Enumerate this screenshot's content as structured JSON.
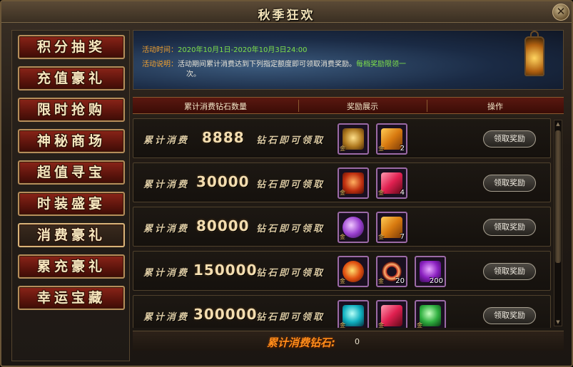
{
  "window": {
    "title": "秋季狂欢",
    "close_label": "✕"
  },
  "sidebar": {
    "items": [
      {
        "label": "积分抽奖",
        "active": false
      },
      {
        "label": "充值豪礼",
        "active": false
      },
      {
        "label": "限时抢购",
        "active": false
      },
      {
        "label": "神秘商场",
        "active": false
      },
      {
        "label": "超值寻宝",
        "active": false
      },
      {
        "label": "时装盛宴",
        "active": false
      },
      {
        "label": "消费豪礼",
        "active": true
      },
      {
        "label": "累充豪礼",
        "active": false
      },
      {
        "label": "幸运宝藏",
        "active": false
      }
    ]
  },
  "banner": {
    "time_label": "活动时间：",
    "time_value": "2020年10月1日-2020年10月3日24:00",
    "desc_label": "活动说明：",
    "desc_text": "活动期间累计消费达到下列指定额度即可领取消费奖励。",
    "desc_limit_line1": "每档奖励限领一",
    "desc_limit_line2": "次。"
  },
  "table": {
    "headers": [
      "累计消费钻石数量",
      "奖励展示",
      "操作"
    ]
  },
  "rows": [
    {
      "prefix": "累计消费",
      "amount": "8888",
      "suffix": "钻石即可领取",
      "button": "领取奖励",
      "items": [
        {
          "icon": "treasure-chest-icon",
          "bind": "金",
          "count": ""
        },
        {
          "icon": "scroll-icon",
          "bind": "金",
          "count": "2"
        }
      ]
    },
    {
      "prefix": "累计消费",
      "amount": "30000",
      "suffix": "钻石即可领取",
      "button": "领取奖励",
      "items": [
        {
          "icon": "red-chest-icon",
          "bind": "金",
          "count": ""
        },
        {
          "icon": "red-crystal-icon",
          "bind": "金",
          "count": "4"
        }
      ]
    },
    {
      "prefix": "累计消费",
      "amount": "80000",
      "suffix": "钻石即可领取",
      "button": "领取奖励",
      "items": [
        {
          "icon": "purple-orb-icon",
          "bind": "金",
          "count": ""
        },
        {
          "icon": "scroll-icon",
          "bind": "金",
          "count": "7"
        }
      ]
    },
    {
      "prefix": "累计消费",
      "amount": "150000",
      "suffix": "钻石即可领取",
      "button": "领取奖励",
      "items": [
        {
          "icon": "fire-orb-icon",
          "bind": "金",
          "count": ""
        },
        {
          "icon": "bead-bracelet-icon",
          "bind": "金",
          "count": "20"
        },
        {
          "icon": "purple-gem-icon",
          "bind": "",
          "count": "200"
        }
      ]
    },
    {
      "prefix": "累计消费",
      "amount": "300000",
      "suffix": "钻石即可领取",
      "button": "领取奖励",
      "items": [
        {
          "icon": "cyan-gem-icon",
          "bind": "金",
          "count": ""
        },
        {
          "icon": "red-crystal-icon",
          "bind": "金",
          "count": ""
        },
        {
          "icon": "green-gem-icon",
          "bind": "金",
          "count": ""
        }
      ]
    }
  ],
  "footer": {
    "label": "累计消费钻石:",
    "value": "0"
  },
  "colors": {
    "accent_orange": "#ff8c1a",
    "highlight_green": "#7ee04a",
    "label_orange": "#f0a030"
  }
}
